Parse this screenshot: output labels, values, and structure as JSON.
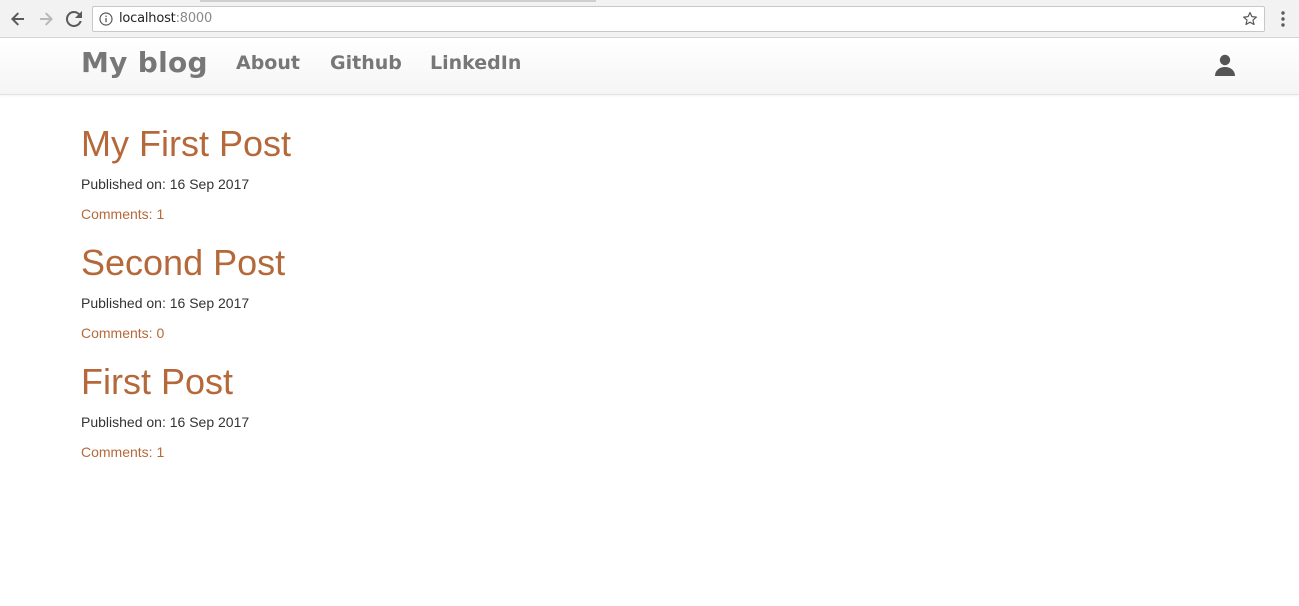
{
  "browser": {
    "url_host": "localhost",
    "url_port": ":8000"
  },
  "navbar": {
    "brand": "My blog",
    "links": [
      {
        "label": "About"
      },
      {
        "label": "Github"
      },
      {
        "label": "LinkedIn"
      }
    ],
    "user_icon": "user-icon"
  },
  "colors": {
    "accent": "#b5693a",
    "nav_text": "#777777",
    "body_text": "#333333"
  },
  "posts": [
    {
      "title": "My First Post",
      "published": "Published on: 16 Sep 2017",
      "comments": "Comments: 1"
    },
    {
      "title": "Second Post",
      "published": "Published on: 16 Sep 2017",
      "comments": "Comments: 0"
    },
    {
      "title": "First Post",
      "published": "Published on: 16 Sep 2017",
      "comments": "Comments: 1"
    }
  ]
}
